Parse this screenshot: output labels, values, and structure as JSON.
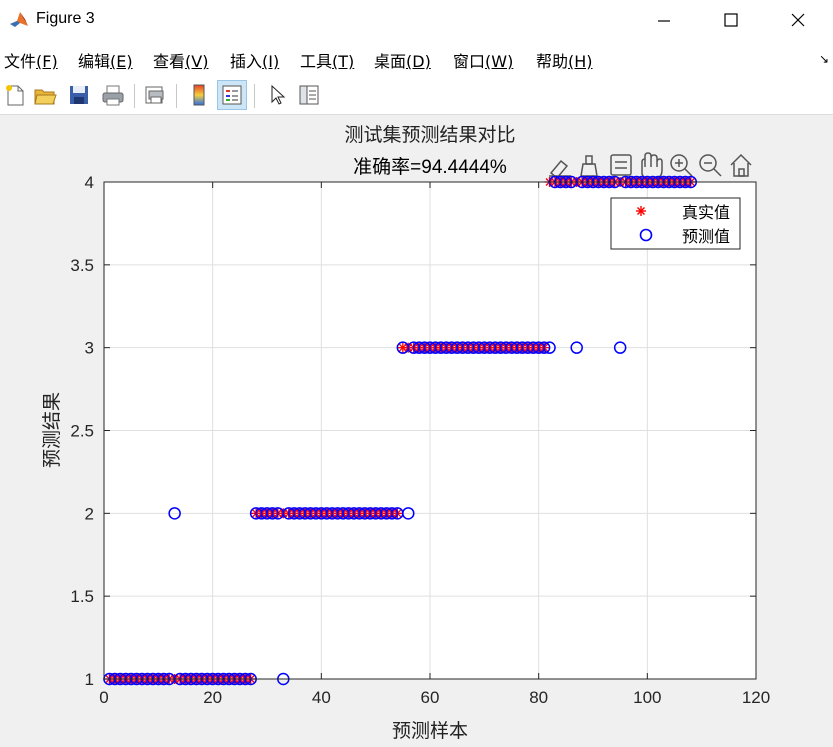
{
  "window": {
    "title": "Figure 3"
  },
  "menu": [
    {
      "label": "文件",
      "key": "(F)"
    },
    {
      "label": "编辑",
      "key": "(E)"
    },
    {
      "label": "查看",
      "key": "(V)"
    },
    {
      "label": "插入",
      "key": "(I)"
    },
    {
      "label": "工具",
      "key": "(T)"
    },
    {
      "label": "桌面",
      "key": "(D)"
    },
    {
      "label": "窗口",
      "key": "(W)"
    },
    {
      "label": "帮助",
      "key": "(H)"
    }
  ],
  "toolbar_icons": [
    "new-figure-icon",
    "open-file-icon",
    "save-icon",
    "print-icon",
    "print-preview-icon",
    "colorbar-icon",
    "legend-icon",
    "select-pointer-icon",
    "property-inspector-icon"
  ],
  "axes_toolbar_icons": [
    "data-tips-icon",
    "brush-icon",
    "edit-legend-icon",
    "pan-icon",
    "zoom-in-icon",
    "zoom-out-icon",
    "home-icon"
  ],
  "colors": {
    "true_marker": "#ff0000",
    "pred_marker": "#0000ff",
    "grid": "#dfdfdf"
  },
  "chart_data": {
    "type": "scatter",
    "title": "测试集预测结果对比",
    "subtitle": "准确率=94.4444%",
    "xlabel": "预测样本",
    "ylabel": "预测结果",
    "xlim": [
      0,
      120
    ],
    "ylim": [
      1,
      4
    ],
    "xticks": [
      0,
      20,
      40,
      60,
      80,
      100,
      120
    ],
    "yticks": [
      1,
      1.5,
      2,
      2.5,
      3,
      3.5,
      4
    ],
    "grid": true,
    "legend": {
      "position": "top-right",
      "entries": [
        "真实值",
        "预测值"
      ]
    },
    "series": [
      {
        "name": "真实值",
        "marker": "*",
        "x": [
          1,
          2,
          3,
          4,
          5,
          6,
          7,
          8,
          9,
          10,
          11,
          12,
          13,
          14,
          15,
          16,
          17,
          18,
          19,
          20,
          21,
          22,
          23,
          24,
          25,
          26,
          27,
          28,
          29,
          30,
          31,
          32,
          33,
          34,
          35,
          36,
          37,
          38,
          39,
          40,
          41,
          42,
          43,
          44,
          45,
          46,
          47,
          48,
          49,
          50,
          51,
          52,
          53,
          54,
          55,
          56,
          57,
          58,
          59,
          60,
          61,
          62,
          63,
          64,
          65,
          66,
          67,
          68,
          69,
          70,
          71,
          72,
          73,
          74,
          75,
          76,
          77,
          78,
          79,
          80,
          81,
          82,
          83,
          84,
          85,
          86,
          87,
          88,
          89,
          90,
          91,
          92,
          93,
          94,
          95,
          96,
          97,
          98,
          99,
          100,
          101,
          102,
          103,
          104,
          105,
          106,
          107,
          108
        ],
        "y": [
          1,
          1,
          1,
          1,
          1,
          1,
          1,
          1,
          1,
          1,
          1,
          1,
          1,
          1,
          1,
          1,
          1,
          1,
          1,
          1,
          1,
          1,
          1,
          1,
          1,
          1,
          1,
          2,
          2,
          2,
          2,
          2,
          2,
          2,
          2,
          2,
          2,
          2,
          2,
          2,
          2,
          2,
          2,
          2,
          2,
          2,
          2,
          2,
          2,
          2,
          2,
          2,
          2,
          2,
          3,
          3,
          3,
          3,
          3,
          3,
          3,
          3,
          3,
          3,
          3,
          3,
          3,
          3,
          3,
          3,
          3,
          3,
          3,
          3,
          3,
          3,
          3,
          3,
          3,
          3,
          3,
          4,
          4,
          4,
          4,
          4,
          4,
          4,
          4,
          4,
          4,
          4,
          4,
          4,
          4,
          4,
          4,
          4,
          4,
          4,
          4,
          4,
          4,
          4,
          4,
          4,
          4,
          4
        ]
      },
      {
        "name": "预测值",
        "marker": "o",
        "x": [
          1,
          2,
          3,
          4,
          5,
          6,
          7,
          8,
          9,
          10,
          11,
          12,
          13,
          14,
          15,
          16,
          17,
          18,
          19,
          20,
          21,
          22,
          23,
          24,
          25,
          26,
          27,
          28,
          29,
          30,
          31,
          32,
          33,
          34,
          35,
          36,
          37,
          38,
          39,
          40,
          41,
          42,
          43,
          44,
          45,
          46,
          47,
          48,
          49,
          50,
          51,
          52,
          53,
          54,
          55,
          56,
          57,
          58,
          59,
          60,
          61,
          62,
          63,
          64,
          65,
          66,
          67,
          68,
          69,
          70,
          71,
          72,
          73,
          74,
          75,
          76,
          77,
          78,
          79,
          80,
          81,
          82,
          83,
          84,
          85,
          86,
          87,
          88,
          89,
          90,
          91,
          92,
          93,
          94,
          95,
          96,
          97,
          98,
          99,
          100,
          101,
          102,
          103,
          104,
          105,
          106,
          107,
          108
        ],
        "y": [
          1,
          1,
          1,
          1,
          1,
          1,
          1,
          1,
          1,
          1,
          1,
          1,
          2,
          1,
          1,
          1,
          1,
          1,
          1,
          1,
          1,
          1,
          1,
          1,
          1,
          1,
          1,
          2,
          2,
          2,
          2,
          2,
          1,
          2,
          2,
          2,
          2,
          2,
          2,
          2,
          2,
          2,
          2,
          2,
          2,
          2,
          2,
          2,
          2,
          2,
          2,
          2,
          2,
          2,
          3,
          2,
          3,
          3,
          3,
          3,
          3,
          3,
          3,
          3,
          3,
          3,
          3,
          3,
          3,
          3,
          3,
          3,
          3,
          3,
          3,
          3,
          3,
          3,
          3,
          3,
          3,
          3,
          4,
          4,
          4,
          4,
          3,
          4,
          4,
          4,
          4,
          4,
          4,
          4,
          3,
          4,
          4,
          4,
          4,
          4,
          4,
          4,
          4,
          4,
          4,
          4,
          4,
          4
        ]
      }
    ]
  }
}
